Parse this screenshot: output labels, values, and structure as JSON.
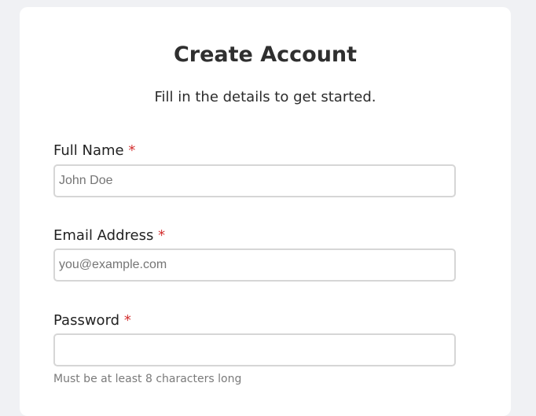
{
  "form": {
    "title": "Create Account",
    "subtitle": "Fill in the details to get started.",
    "required_marker": "*",
    "fields": [
      {
        "label": "Full Name",
        "placeholder": "John Doe",
        "value": ""
      },
      {
        "label": "Email Address",
        "placeholder": "you@example.com",
        "value": ""
      },
      {
        "label": "Password",
        "placeholder": "",
        "value": "",
        "hint": "Must be at least 8 characters long"
      }
    ]
  },
  "colors": {
    "background": "#f0f1f4",
    "card": "#ffffff",
    "required": "#d32f2f",
    "input_border": "#d6d6d6",
    "hint": "#7a7a7a"
  }
}
